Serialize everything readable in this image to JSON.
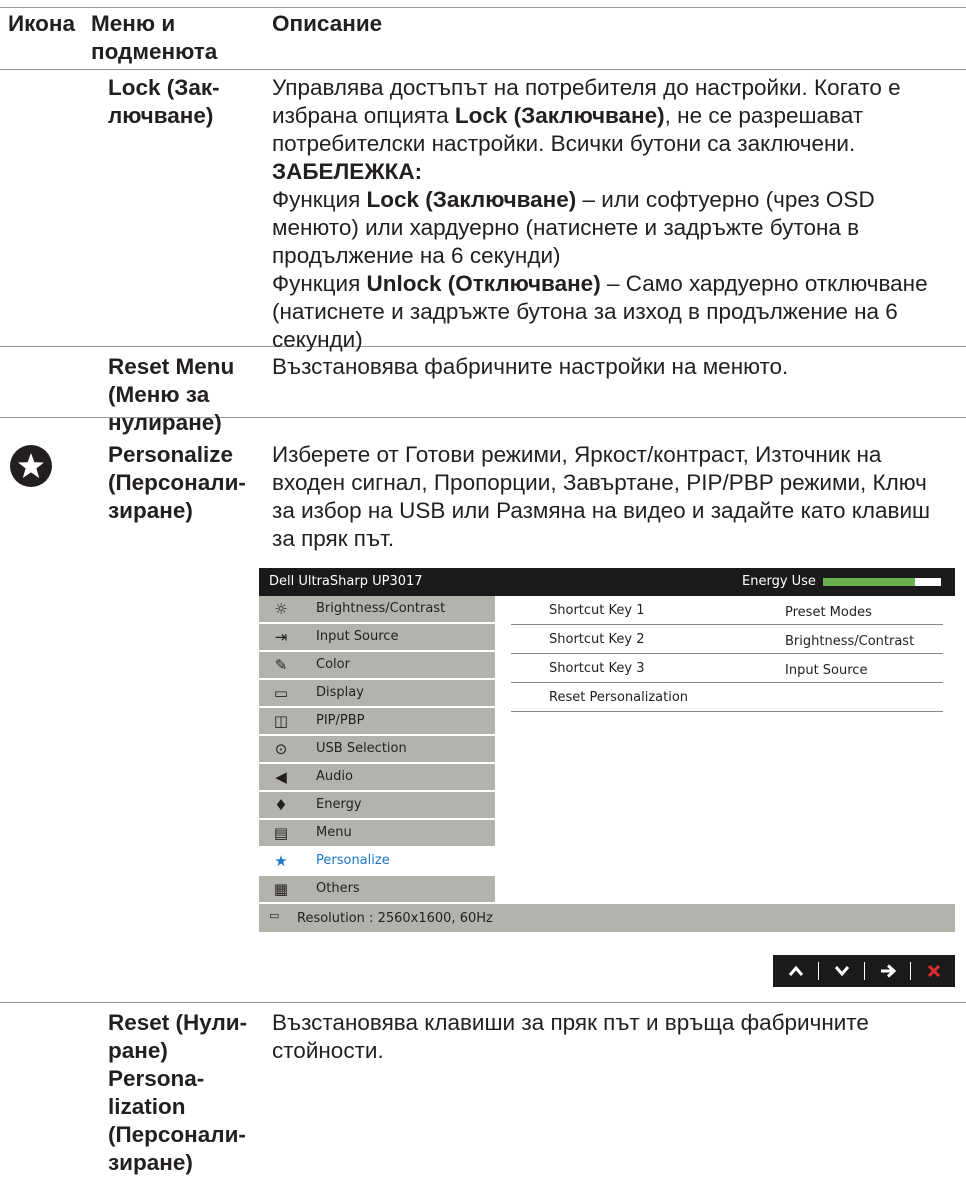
{
  "header": {
    "col_icon": "Икона",
    "col_menu_line1": "Меню и",
    "col_menu_line2": "подменюта",
    "col_desc": "Описание"
  },
  "rows": {
    "lock": {
      "menu_line1": "Lock (Зак-",
      "menu_line2": "лючване)",
      "p1_before": "Управлява достъпът на потребителя до настройки. Когато е избрана опцията ",
      "p1_bold": "Lock (Заключване)",
      "p1_after": ", не се разрешават потребителски настройки. Всички бутони са заключени.",
      "note_label": "ЗАБЕЛЕЖКА:",
      "p2_before": "Функция ",
      "p2_bold": "Lock (Заключване)",
      "p2_after": " – или софтуерно (чрез OSD менюто) или хардуерно (натиснете и задръжте бутона в продължение на 6 секунди)",
      "p3_before": "Функция ",
      "p3_bold": "Unlock (Отключване)",
      "p3_after": " – Само хардуерно отключване (натиснете и задръжте бутона за изход в продължение на 6 секунди)"
    },
    "reset_menu": {
      "menu_line1": "Reset Menu",
      "menu_line2": "(Меню за",
      "menu_line3": "нулиране)",
      "desc": "Възстановява фабричните настройки на менюто."
    },
    "personalize": {
      "icon": "star-icon",
      "menu_line1": "Personalize",
      "menu_line2": "(Персонали-",
      "menu_line3": "зиране)",
      "desc": "Изберете от Готови режими, Яркост/контраст, Източник на входен сигнал, Пропорции, Завъртане, PIP/PBP режими, Ключ за избор на USB или Размяна на видео и задайте като клавиш за пряк път."
    },
    "reset_personalization": {
      "menu_line1": "Reset (Нули-",
      "menu_line2": "ране)",
      "menu_line3": "Persona-",
      "menu_line4": "lization",
      "menu_line5": "(Персонали-",
      "menu_line6": "зиране)",
      "desc": "Възстановява клавиши за пряк път и връща фабричните стойности."
    }
  },
  "osd": {
    "title": "Dell UltraSharp UP3017",
    "energy_label": "Energy Use",
    "energy_level": 0.78,
    "accent_color": "#2076c8",
    "energy_color": "#6ab04c",
    "menu_items": [
      {
        "label": "Brightness/Contrast",
        "icon": "sun-icon"
      },
      {
        "label": "Input Source",
        "icon": "input-arrow-icon"
      },
      {
        "label": "Color",
        "icon": "palette-icon"
      },
      {
        "label": "Display",
        "icon": "monitor-icon"
      },
      {
        "label": "PIP/PBP",
        "icon": "pip-icon"
      },
      {
        "label": "USB Selection",
        "icon": "mouse-icon"
      },
      {
        "label": "Audio",
        "icon": "speaker-icon"
      },
      {
        "label": "Energy",
        "icon": "flame-icon"
      },
      {
        "label": "Menu",
        "icon": "menu-icon"
      },
      {
        "label": "Personalize",
        "icon": "star-icon",
        "selected": true
      },
      {
        "label": "Others",
        "icon": "others-icon"
      }
    ],
    "settings": [
      {
        "key": "Shortcut Key 1",
        "value": "Preset Modes"
      },
      {
        "key": "Shortcut Key 2",
        "value": "Brightness/Contrast"
      },
      {
        "key": "Shortcut Key 3",
        "value": "Input Source"
      },
      {
        "key": "Reset Personalization",
        "value": ""
      }
    ],
    "status": "Resolution : 2560x1600, 60Hz",
    "nav": {
      "up": "^",
      "down": "v",
      "right": "→",
      "close": "✕"
    }
  }
}
